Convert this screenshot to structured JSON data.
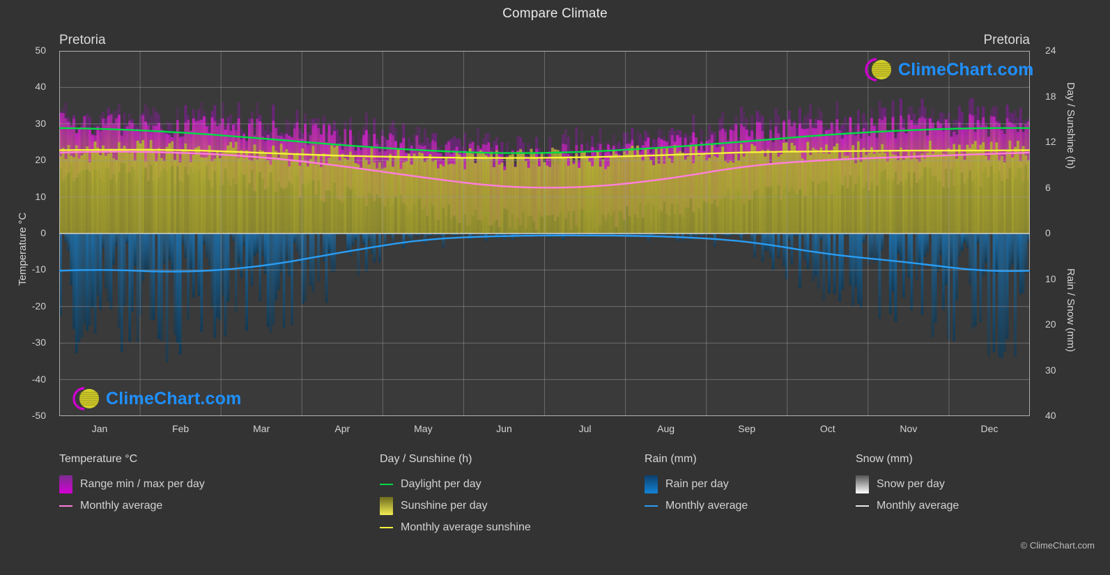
{
  "header": {
    "title": "Compare Climate",
    "city_left": "Pretoria",
    "city_right": "Pretoria"
  },
  "copyright": "© ClimeChart.com",
  "watermark": {
    "text": "ClimeChart.com",
    "ring_color": "#cc00cc",
    "sphere_color": "#d4cf2a",
    "text_color": "#1e90ff"
  },
  "axes": {
    "left_label": "Temperature °C",
    "right_top_label": "Day / Sunshine (h)",
    "right_bottom_label": "Rain / Snow (mm)",
    "left_ticks": [
      50,
      40,
      30,
      20,
      10,
      0,
      -10,
      -20,
      -30,
      -40,
      -50
    ],
    "right_top_ticks": [
      24,
      18,
      12,
      6,
      0
    ],
    "right_bottom_ticks": [
      10,
      20,
      30,
      40
    ]
  },
  "legend": {
    "groups": [
      {
        "heading": "Temperature °C",
        "items": [
          {
            "label": "Range min / max per day",
            "marker": "swatch",
            "color": "#d400d4",
            "color2": "#7a2d8f"
          },
          {
            "label": "Monthly average",
            "marker": "line",
            "color": "#ff7fdc"
          }
        ]
      },
      {
        "heading": "Day / Sunshine (h)",
        "items": [
          {
            "label": "Daylight per day",
            "marker": "line",
            "color": "#00dd44"
          },
          {
            "label": "Sunshine per day",
            "marker": "swatch",
            "color": "#f2ee54",
            "color2": "#6e6a1e"
          },
          {
            "label": "Monthly average sunshine",
            "marker": "line",
            "color": "#f6f43a"
          }
        ]
      },
      {
        "heading": "Rain (mm)",
        "items": [
          {
            "label": "Rain per day",
            "marker": "swatch",
            "color": "#1284d6",
            "color2": "#0d3f6b"
          },
          {
            "label": "Monthly average",
            "marker": "line",
            "color": "#2a9df4"
          }
        ]
      },
      {
        "heading": "Snow (mm)",
        "items": [
          {
            "label": "Snow per day",
            "marker": "swatch",
            "color": "#ffffff",
            "color2": "#555555"
          },
          {
            "label": "Monthly average",
            "marker": "line",
            "color": "#e8e8e8"
          }
        ]
      }
    ]
  },
  "chart_data": {
    "type": "area",
    "title": "Compare Climate",
    "subtitle": "Pretoria",
    "location": "Pretoria",
    "xlabel": "",
    "ylabel": "Temperature °C",
    "y2label_top": "Day / Sunshine (h)",
    "y2label_bottom": "Rain / Snow (mm)",
    "ylim": [
      -50,
      50
    ],
    "y2lim_sunshine": [
      0,
      24
    ],
    "y2lim_rain": [
      0,
      40
    ],
    "grid": true,
    "legend_position": "below",
    "categories": [
      "Jan",
      "Feb",
      "Mar",
      "Apr",
      "May",
      "Jun",
      "Jul",
      "Aug",
      "Sep",
      "Oct",
      "Nov",
      "Dec"
    ],
    "tick_labels_x": [
      "Jan",
      "Feb",
      "Mar",
      "Apr",
      "May",
      "Jun",
      "Jul",
      "Aug",
      "Sep",
      "Oct",
      "Nov",
      "Dec"
    ],
    "series": [
      {
        "name": "Monthly average temperature",
        "unit": "°C",
        "color": "#ff7fdc",
        "values": [
          22.5,
          22.2,
          21.0,
          18.5,
          15.3,
          12.6,
          12.5,
          14.8,
          18.6,
          20.2,
          21.0,
          21.8
        ]
      },
      {
        "name": "Temperature range max per day",
        "unit": "°C",
        "color": "#d400d4",
        "values": [
          29.5,
          29.0,
          28.0,
          26.0,
          23.5,
          21.0,
          21.0,
          23.5,
          27.0,
          28.5,
          29.0,
          29.5
        ]
      },
      {
        "name": "Temperature range min per day",
        "unit": "°C",
        "color": "#d400d4",
        "values": [
          16.5,
          16.2,
          14.5,
          11.0,
          7.0,
          3.5,
          3.5,
          6.5,
          10.5,
          13.5,
          15.0,
          16.0
        ]
      },
      {
        "name": "Daylight per day",
        "unit": "h",
        "color": "#00dd44",
        "values": [
          13.8,
          13.3,
          12.5,
          11.6,
          10.9,
          10.5,
          10.7,
          11.3,
          12.1,
          13.0,
          13.6,
          13.9
        ]
      },
      {
        "name": "Monthly average sunshine",
        "unit": "h",
        "color": "#f6f43a",
        "values": [
          11.0,
          11.0,
          10.6,
          10.2,
          10.0,
          9.9,
          10.0,
          10.3,
          10.7,
          10.8,
          10.9,
          10.9
        ]
      },
      {
        "name": "Rain monthly average",
        "unit": "mm",
        "color": "#2a9df4",
        "values": [
          7.8,
          8.6,
          7.3,
          4.1,
          1.2,
          0.5,
          0.4,
          0.6,
          1.6,
          4.6,
          6.3,
          8.5
        ]
      },
      {
        "name": "Snow monthly average",
        "unit": "mm",
        "color": "#e8e8e8",
        "values": [
          0,
          0,
          0,
          0,
          0,
          0,
          0,
          0,
          0,
          0,
          0,
          0
        ]
      }
    ]
  }
}
